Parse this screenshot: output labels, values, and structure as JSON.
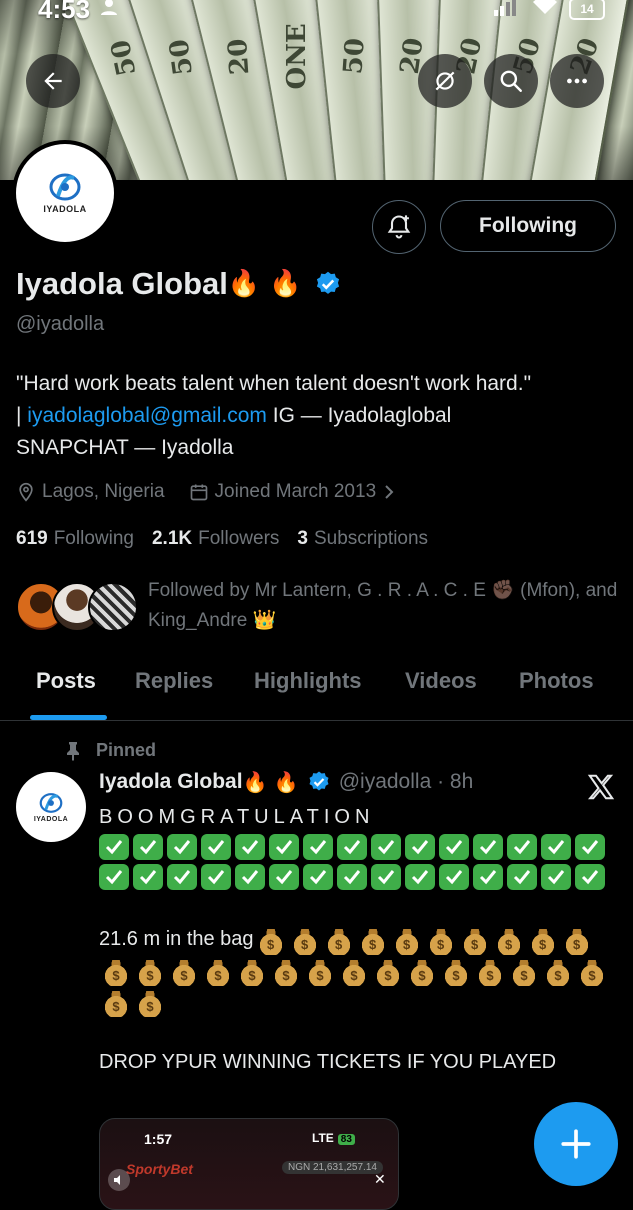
{
  "status_bar": {
    "time": "4:53",
    "battery": "14"
  },
  "banner": {
    "bill_labels": [
      "50",
      "50",
      "20",
      "ONE",
      "50",
      "20",
      "20",
      "50",
      "20"
    ]
  },
  "profile": {
    "logo_text": "IYADOLA",
    "follow_button_label": "Following",
    "display_name": "Iyadola Global",
    "name_emoji": "🔥 🔥",
    "handle": "@iyadolla",
    "bio_line1": "\"Hard work beats talent when talent doesn't work hard.\"",
    "bio_separator": "| ",
    "bio_email": "iyadolaglobal@gmail.com",
    "bio_after_email": " IG — Iyadolaglobal",
    "bio_line3": "SNAPCHAT — Iyadolla",
    "location": "Lagos, Nigeria",
    "joined": "Joined March 2013",
    "following_count": "619",
    "following_label": "Following",
    "followers_count": "2.1K",
    "followers_label": "Followers",
    "subscriptions_count": "3",
    "subscriptions_label": "Subscriptions",
    "followed_by": "Followed by Mr Lantern, G . R . A . C . E ✊🏿 (Mfon), and King_Andre 👑"
  },
  "tabs": [
    "Posts",
    "Replies",
    "Highlights",
    "Videos",
    "Photos"
  ],
  "active_tab": "Posts",
  "post": {
    "pinned_label": "Pinned",
    "author_name": "Iyadola Global",
    "author_emoji": "🔥 🔥",
    "handle_time": "@iyadolla · 8h",
    "line1": "BOOMGRATULATION",
    "checkmark_count": 30,
    "line2": "21.6 m in the bag",
    "money_bag_count": 27,
    "bag_symbol": "$",
    "line3": "DROP YPUR WINNING TICKETS IF YOU PLAYED",
    "media": {
      "time": "1:57",
      "network": "LTE",
      "battery": "83",
      "brand": "SportyBet",
      "balance": "NGN 21,631,257.14",
      "close": "✕"
    }
  },
  "colors": {
    "accent": "#1d9bf0",
    "muted": "#71767b",
    "text": "#e7e9ea",
    "check_green": "#3fae49"
  }
}
